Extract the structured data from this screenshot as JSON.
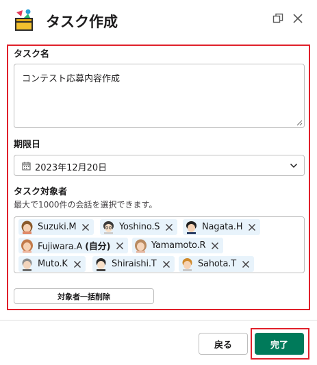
{
  "dialog": {
    "title": "タスク作成",
    "icons": {
      "app": "shapes-box-icon",
      "copy": "copy-window-icon",
      "close": "close-icon"
    }
  },
  "task_name": {
    "label": "タスク名",
    "value": "コンテスト応募内容作成"
  },
  "due_date": {
    "label": "期限日",
    "value": "2023年12月20日",
    "icon": "calendar-icon"
  },
  "assignees": {
    "label": "タスク対象者",
    "helper": "最大で1000件の会話を選択できます。",
    "chips": [
      {
        "name": "Suzuki.M",
        "suffix": ""
      },
      {
        "name": "Yoshino.S",
        "suffix": ""
      },
      {
        "name": "Nagata.H",
        "suffix": ""
      },
      {
        "name": "Fujiwara.A",
        "suffix": "(自分)"
      },
      {
        "name": "Yamamoto.R",
        "suffix": ""
      },
      {
        "name": "Muto.K",
        "suffix": ""
      },
      {
        "name": "Shiraishi.T",
        "suffix": ""
      },
      {
        "name": "Sahota.T",
        "suffix": ""
      }
    ],
    "clear_button": "対象者一括削除"
  },
  "footer": {
    "back_button": "戻る",
    "done_button": "完了"
  },
  "colors": {
    "accent": "#007a5a",
    "highlight": "#e0202a",
    "chip_bg": "#e8f3fb"
  }
}
